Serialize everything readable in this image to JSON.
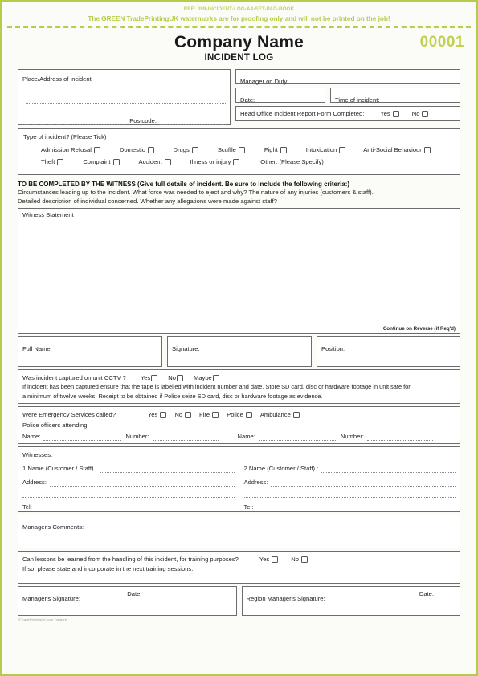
{
  "proof": {
    "ref": "REF: 099-INCIDENT-LOG-A4-SET-PAD-BOOK",
    "note": "The GREEN TradePrintingUK watermarks are for proofing only and will not be printed on the job!"
  },
  "colors": {
    "green": "#b5cc4a",
    "serial_green": "#c3d14e",
    "rule": "#6d6d6d",
    "text": "#222222"
  },
  "header": {
    "company_name": "Company Name",
    "subtitle": "INCIDENT LOG",
    "serial": "00001"
  },
  "place": {
    "label": "Place/Address of incident",
    "postcode_label": "Postcode:"
  },
  "details": {
    "manager_on_duty": "Manager on Duty:",
    "date": "Date:",
    "time_of_incident": "Time of incident:",
    "head_office": "Head Office Incident Report Form Completed:",
    "yes": "Yes",
    "no": "No"
  },
  "incident_type": {
    "heading": "Type of incident? (Please Tick)",
    "row1": [
      "Admission Refusal",
      "Domestic",
      "Drugs",
      "Scuffle",
      "Fight",
      "Intoxication",
      "Anti-Social Behaviour"
    ],
    "row2": [
      "Theft",
      "Complaint",
      "Accident",
      "Illness or injury"
    ],
    "other_label": "Other: (Please Specify)"
  },
  "instructions": {
    "heading": "TO BE COMPLETED BY THE WITNESS (Give full details of incident. Be sure to include the following criteria:)",
    "line1": "Circumstances leading up to the incident. What force was needed to eject and why? The nature of any injuries (customers & staff).",
    "line2": "Detailed description of individual concerned. Whether any allegations were made against staff?"
  },
  "witness_statement": {
    "label": "Witness Statement",
    "continue_note": "Continue on Reverse (if Req'd)"
  },
  "identity": {
    "full_name": "Full Name:",
    "signature": "Signature:",
    "position": "Position:"
  },
  "cctv": {
    "question": "Was incident captured on unit CCTV ?",
    "options": [
      "Yes",
      "No",
      "Maybe"
    ],
    "note_line1": "If incident has been captured ensure that the tape is labelled with incident number and date. Store SD card, disc or hardware footage in unit safe for",
    "note_line2": "a minimum of twelve weeks. Receipt to be obtained if Police seize SD card, disc or hardware footage as evidence."
  },
  "emergency": {
    "question": "Were Emergency Services called?",
    "options": [
      "Yes",
      "No",
      "Fire",
      "Police",
      "Ambulance"
    ],
    "attending_label": "Police officers attending:",
    "name_label": "Name:",
    "number_label": "Number:"
  },
  "witnesses": {
    "heading": "Witnesses:",
    "name1": "1.Name (Customer / Staff) :",
    "name2": "2.Name (Customer / Staff) :",
    "address_label": "Address:",
    "tel_label": "Tel:"
  },
  "manager_comments": {
    "label": "Manager's Comments:"
  },
  "lessons": {
    "question": "Can lessons be learned from the handling of this incident, for training purposes?",
    "yes": "Yes",
    "no": "No",
    "followup": "If so, please state and incorporate in the next training sessions:"
  },
  "signatures": {
    "manager": "Manager's Signature:",
    "region_manager": "Region Manager's Signature:",
    "date": "Date:"
  },
  "footer": {
    "credit": "©TradePrintingUK.com  Trade-ref"
  }
}
